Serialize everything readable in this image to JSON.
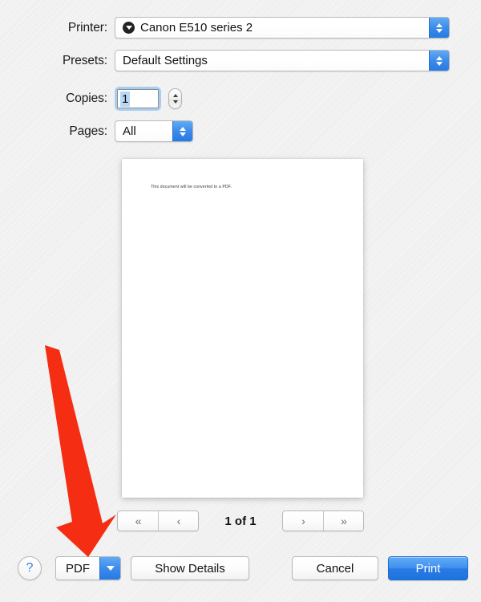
{
  "dialog": {
    "rows": [
      {
        "label": "Printer:",
        "value": "Canon E510 series 2",
        "icon": "printer-status-icon"
      },
      {
        "label": "Presets:",
        "value": "Default Settings"
      },
      {
        "label": "Copies:",
        "value": "1"
      },
      {
        "label": "Pages:",
        "value": "All"
      }
    ]
  },
  "preview": {
    "text": "This document will be converted to a PDF."
  },
  "pagination": {
    "first_label": "«",
    "prev_label": "‹",
    "indicator": "1 of 1",
    "next_label": "›",
    "last_label": "»"
  },
  "bottom_bar": {
    "help_label": "?",
    "pdf_label": "PDF",
    "show_details_label": "Show Details",
    "cancel_label": "Cancel",
    "print_label": "Print"
  },
  "annotation": {
    "arrow_color": "#f42d13"
  },
  "colors": {
    "accent_blue": "#2a7ae6",
    "popup_arrow_blue": "#3b8ceb",
    "selection_blue": "#b9d6f5",
    "focus_ring": "#6eaff0",
    "background": "#f1f1f1",
    "help_glyph": "#2f7fe0"
  }
}
